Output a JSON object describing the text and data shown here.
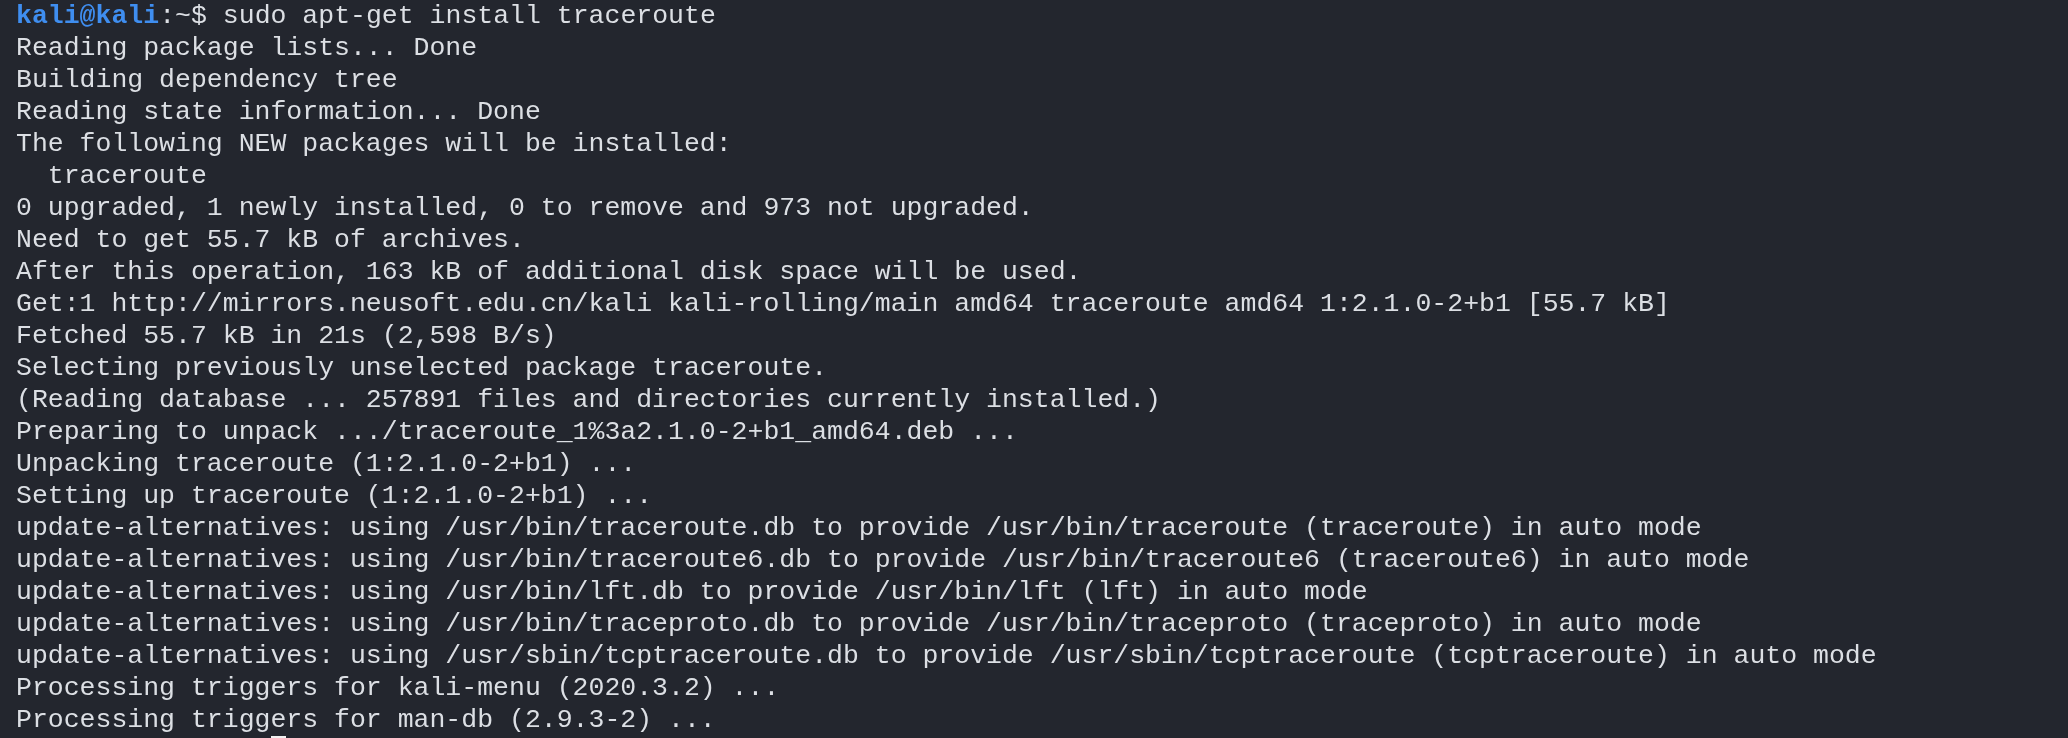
{
  "prompt": {
    "user_host": "kali@kali",
    "path": ":~",
    "symbol": "$",
    "command": "sudo apt-get install traceroute"
  },
  "output": [
    "Reading package lists... Done",
    "Building dependency tree",
    "Reading state information... Done",
    "The following NEW packages will be installed:",
    "  traceroute",
    "0 upgraded, 1 newly installed, 0 to remove and 973 not upgraded.",
    "Need to get 55.7 kB of archives.",
    "After this operation, 163 kB of additional disk space will be used.",
    "Get:1 http://mirrors.neusoft.edu.cn/kali kali-rolling/main amd64 traceroute amd64 1:2.1.0-2+b1 [55.7 kB]",
    "Fetched 55.7 kB in 21s (2,598 B/s)",
    "Selecting previously unselected package traceroute.",
    "(Reading database ... 257891 files and directories currently installed.)",
    "Preparing to unpack .../traceroute_1%3a2.1.0-2+b1_amd64.deb ...",
    "Unpacking traceroute (1:2.1.0-2+b1) ...",
    "Setting up traceroute (1:2.1.0-2+b1) ...",
    "update-alternatives: using /usr/bin/traceroute.db to provide /usr/bin/traceroute (traceroute) in auto mode",
    "update-alternatives: using /usr/bin/traceroute6.db to provide /usr/bin/traceroute6 (traceroute6) in auto mode",
    "update-alternatives: using /usr/bin/lft.db to provide /usr/bin/lft (lft) in auto mode",
    "update-alternatives: using /usr/bin/traceproto.db to provide /usr/bin/traceproto (traceproto) in auto mode",
    "update-alternatives: using /usr/sbin/tcptraceroute.db to provide /usr/sbin/tcptraceroute (tcptraceroute) in auto mode",
    "Processing triggers for kali-menu (2020.3.2) ...",
    "Processing triggers for man-db (2.9.3-2) ..."
  ],
  "cursor": true
}
